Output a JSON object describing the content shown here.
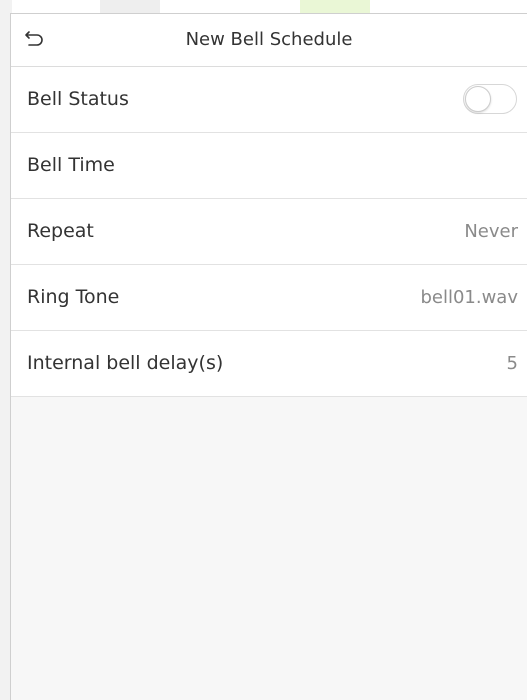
{
  "header": {
    "title": "New Bell Schedule",
    "back_icon": "back-arrow-icon"
  },
  "rows": [
    {
      "label": "Bell Status",
      "value": "",
      "control": "toggle",
      "toggle_on": false
    },
    {
      "label": "Bell Time",
      "value": ""
    },
    {
      "label": "Repeat",
      "value": "Never"
    },
    {
      "label": "Ring Tone",
      "value": "bell01.wav"
    },
    {
      "label": "Internal bell delay(s)",
      "value": "5"
    }
  ],
  "colors": {
    "header_bg": "#ffffff",
    "screen_bg": "#f7f7f7",
    "text": "#333333",
    "value_text": "#8a8a8a",
    "divider": "#e2e2e2"
  }
}
